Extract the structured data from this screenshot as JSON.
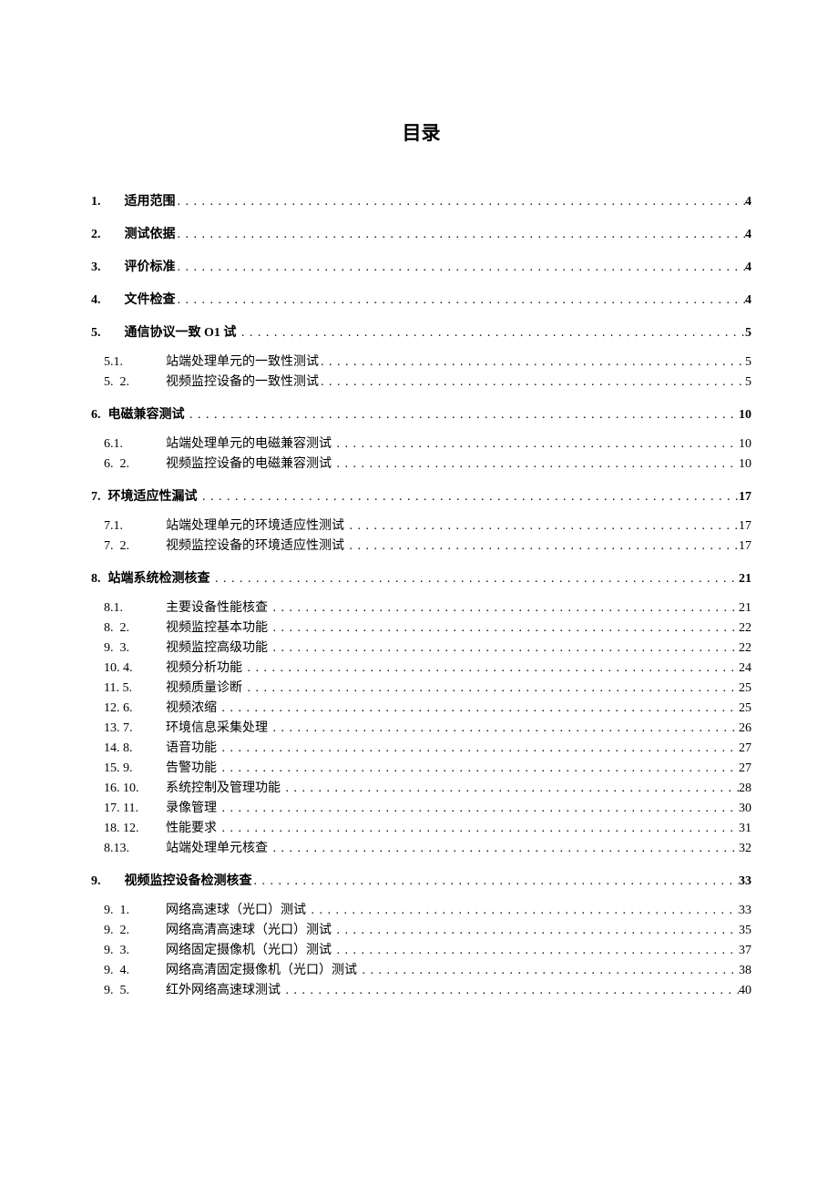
{
  "title": "目录",
  "entries": [
    {
      "level": 1,
      "num": "1.",
      "text": "适用范围",
      "page": "4"
    },
    {
      "level": 1,
      "num": "2.",
      "text": "测试依据",
      "page": "4"
    },
    {
      "level": 1,
      "num": "3.",
      "text": "评价标准",
      "page": "4"
    },
    {
      "level": 1,
      "num": "4.",
      "text": "文件检查",
      "page": "4"
    },
    {
      "level": 1,
      "num": "5.",
      "text": "通信协议一致 O1 试 ",
      "page": "5"
    },
    {
      "level": 2,
      "num": "5.1.",
      "text": "站端处理单元的一致性测试",
      "page": "5"
    },
    {
      "level": 2,
      "num": "5.  2.",
      "text": "视频监控设备的一致性测试",
      "page": "5"
    },
    {
      "level": 1,
      "num": "6.",
      "text": "电磁兼容测试 ",
      "page": "10",
      "tight": true
    },
    {
      "level": 2,
      "num": "6.1.",
      "text": "站端处理单元的电磁兼容测试 ",
      "page": "10"
    },
    {
      "level": 2,
      "num": "6.  2.",
      "text": "视频监控设备的电磁兼容测试 ",
      "page": "10"
    },
    {
      "level": 1,
      "num": "7.",
      "text": "环境适应性漏试 ",
      "page": "17",
      "tight": true
    },
    {
      "level": 2,
      "num": "7.1.",
      "text": "站端处理单元的环境适应性测试 ",
      "page": "17"
    },
    {
      "level": 2,
      "num": "7.  2.",
      "text": "视频监控设备的环境适应性测试 ",
      "page": "17"
    },
    {
      "level": 1,
      "num": "8.",
      "text": "站端系统检测核查 ",
      "page": "21",
      "tight": true
    },
    {
      "level": 2,
      "num": "8.1.",
      "text": "主要设备性能核查 ",
      "page": "21"
    },
    {
      "level": 2,
      "num": "8.  2.",
      "text": "视频监控基本功能 ",
      "page": "22"
    },
    {
      "level": 2,
      "num": "9.  3.",
      "text": "视频监控高级功能 ",
      "page": "22"
    },
    {
      "level": 2,
      "num": "10. 4.",
      "text": "视频分析功能 ",
      "page": "24"
    },
    {
      "level": 2,
      "num": "11. 5.",
      "text": "视频质量诊断 ",
      "page": "25"
    },
    {
      "level": 2,
      "num": "12. 6.",
      "text": "视频浓缩 ",
      "page": "25"
    },
    {
      "level": 2,
      "num": "13. 7.",
      "text": "环境信息采集处理 ",
      "page": "26"
    },
    {
      "level": 2,
      "num": "14. 8.",
      "text": "语音功能 ",
      "page": "27"
    },
    {
      "level": 2,
      "num": "15. 9.",
      "text": "告警功能 ",
      "page": "27"
    },
    {
      "level": 2,
      "num": "16. 10.",
      "text": "系统控制及管理功能 ",
      "page": "28"
    },
    {
      "level": 2,
      "num": "17. 11.",
      "text": "录像管理 ",
      "page": "30"
    },
    {
      "level": 2,
      "num": "18. 12.",
      "text": "性能要求 ",
      "page": "31"
    },
    {
      "level": 2,
      "num": "8.13.",
      "text": "站端处理单元核查 ",
      "page": "32"
    },
    {
      "level": 1,
      "num": "9.",
      "text": "视频监控设备检测核查",
      "page": "33"
    },
    {
      "level": 2,
      "num": "9.  1.",
      "text": "网络高速球（光口）测试 ",
      "page": "33"
    },
    {
      "level": 2,
      "num": "9.  2.",
      "text": "网络高清高速球（光口）测试 ",
      "page": "35"
    },
    {
      "level": 2,
      "num": "9.  3.",
      "text": "网络固定摄像机（光口）测试 ",
      "page": "37"
    },
    {
      "level": 2,
      "num": "9.  4.",
      "text": "网络高清固定摄像机（光口）测试 ",
      "page": "38"
    },
    {
      "level": 2,
      "num": "9.  5.",
      "text": "红外网络高速球测试 ",
      "page": "40"
    }
  ]
}
